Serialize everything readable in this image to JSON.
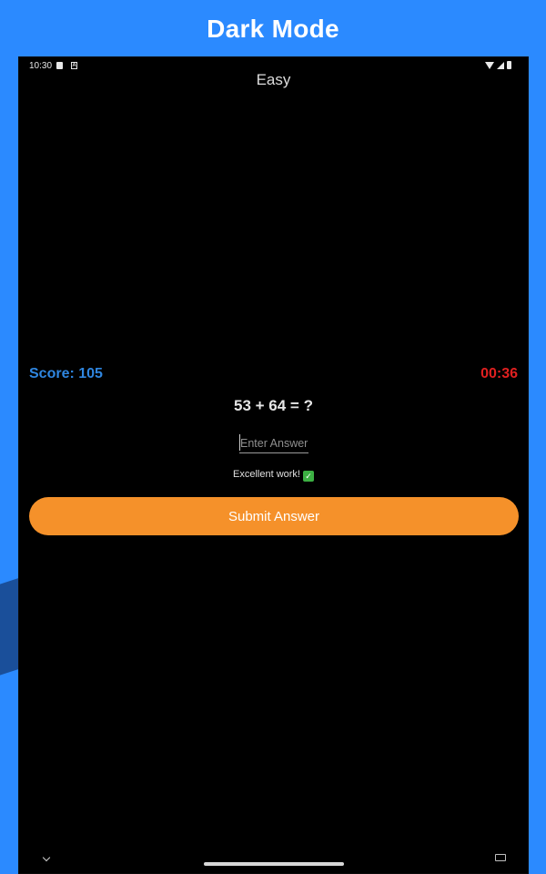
{
  "promo": {
    "title": "Dark Mode"
  },
  "status_bar": {
    "time": "10:30",
    "icons": [
      "sim-card-icon",
      "a-badge-icon",
      "wifi-icon",
      "signal-icon",
      "battery-icon"
    ]
  },
  "game": {
    "level": "Easy",
    "score": "Score: 105",
    "timer": "00:36",
    "question": "53 + 64 = ?",
    "answer_value": "",
    "answer_placeholder": "Enter Answer",
    "feedback": "Excellent work!",
    "feedback_icon": "check-mark-icon",
    "submit_label": "Submit Answer"
  },
  "colors": {
    "background": "#2b8aff",
    "screen": "#000000",
    "score": "#2f86e0",
    "timer": "#e02020",
    "button": "#f5912a"
  },
  "nav_bar": {
    "icons": [
      "chevron-down-icon",
      "home-handle",
      "keyboard-icon"
    ]
  }
}
